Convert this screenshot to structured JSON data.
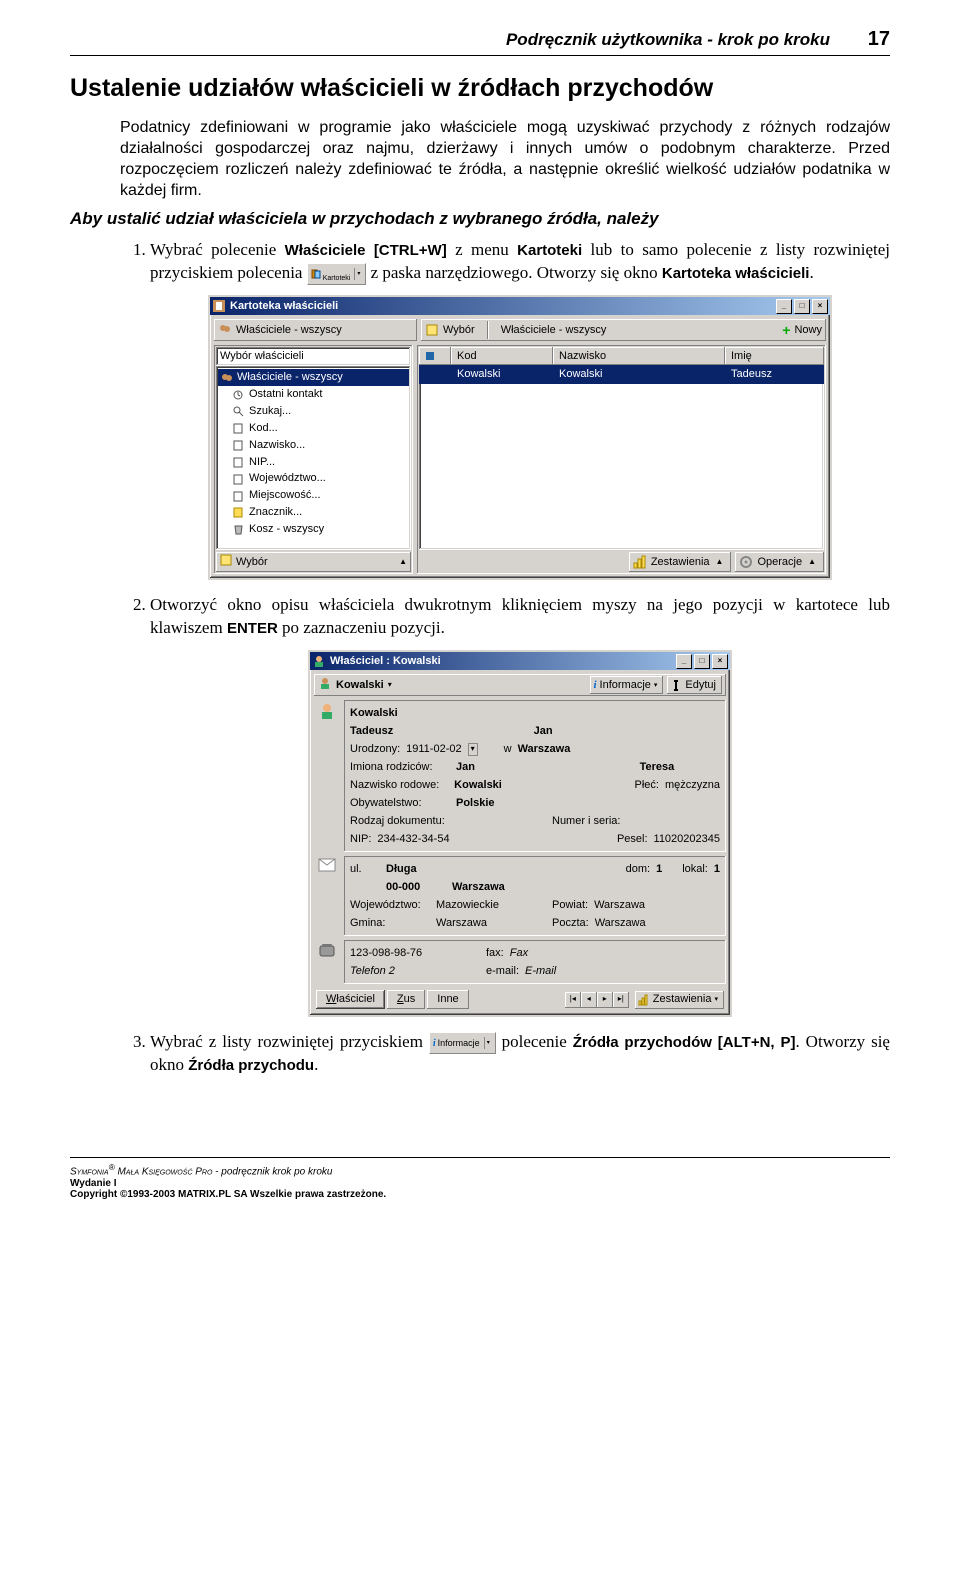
{
  "header": {
    "title": "Podręcznik użytkownika - krok po kroku",
    "page": "17"
  },
  "section_title": "Ustalenie udziałów właścicieli w źródłach przychodów",
  "intro_para": "Podatnicy zdefiniowani w programie jako właściciele mogą uzyskiwać przychody z różnych rodzajów działalności gospodarczej oraz najmu, dzierżawy i innych umów o podobnym charakterze. Przed rozpoczęciem rozliczeń należy zdefiniować te źródła, a następnie określić wielkość udziałów podatnika w każdej firm.",
  "lead_para": "Aby ustalić udział właściciela w przychodach z wybranego źródła, należy",
  "step1_a": "Wybrać polecenie ",
  "step1_b": "Właściciele",
  "step1_c": " [CTRL+W]",
  "step1_d": " z menu ",
  "step1_e": "Kartoteki",
  "step1_f": " lub to samo polecenie z listy rozwiniętej przyciskiem polecenia ",
  "step1_g": " z paska narzędziowego. Otworzy się okno ",
  "step1_h": "Kartoteka właścicieli",
  "kartoteki_btn": "Kartoteki",
  "step2_a": "Otworzyć okno opisu właściciela dwukrotnym kliknięciem myszy na jego pozycji w kartotece lub klawiszem ",
  "step2_b": "ENTER",
  "step2_c": " po zaznaczeniu pozycji.",
  "step3_a": "Wybrać z listy rozwiniętej przyciskiem ",
  "step3_b": " polecenie ",
  "step3_c": "Źródła przychodów",
  "step3_d": " [ALT+N, P]",
  "step3_e": ". Otworzy się okno ",
  "step3_f": "Źródła przychodu",
  "informacje_btn": "Informacje",
  "win1": {
    "title": "Kartoteka właścicieli",
    "toolbar_left": "Właściciele - wszyscy",
    "toolbar_wybor": "Wybór",
    "toolbar_desc": "Właściciele - wszyscy",
    "toolbar_nowy": "Nowy",
    "left_caption": "Wybór właścicieli",
    "tree": [
      "Właściciele - wszyscy",
      "Ostatni kontakt",
      "Szukaj...",
      "Kod...",
      "Nazwisko...",
      "NIP...",
      "Województwo...",
      "Miejscowość...",
      "Znacznik...",
      "Kosz - wszyscy"
    ],
    "left_tab": "Wybór",
    "grid_cols": {
      "c1": "Kod",
      "c2": "Nazwisko",
      "c3": "Imię"
    },
    "grid_row": {
      "c1": "Kowalski",
      "c2": "Kowalski",
      "c3": "Tadeusz"
    },
    "btn_zestawienia": "Zestawienia",
    "btn_operacje": "Operacje"
  },
  "win2": {
    "title": "Właściciel : Kowalski",
    "name_field": "Kowalski",
    "btn_info": "Informacje",
    "btn_edit": "Edytuj",
    "p1": {
      "nazwisko": "Kowalski",
      "imie": "Tadeusz",
      "imie2": "Jan",
      "urodzony_l": "Urodzony:",
      "urodzony_v": "1911-02-02",
      "w_l": "w",
      "w_v": "Warszawa",
      "rodzice_l": "Imiona rodziców:",
      "rodzice_v1": "Jan",
      "rodzice_v2": "Teresa",
      "rodowe_l": "Nazwisko rodowe:",
      "rodowe_v": "Kowalski",
      "plec_l": "Płeć:",
      "plec_v": "mężczyzna",
      "obyw_l": "Obywatelstwo:",
      "obyw_v": "Polskie",
      "dok_l": "Rodzaj dokumentu:",
      "numer_l": "Numer i seria:",
      "nip_l": "NIP:",
      "nip_v": "234-432-34-54",
      "pesel_l": "Pesel:",
      "pesel_v": "11020202345"
    },
    "p2": {
      "ul_l": "ul.",
      "ul_v": "Długa",
      "dom_l": "dom:",
      "dom_v": "1",
      "lokal_l": "lokal:",
      "lokal_v": "1",
      "kod_v": "00-000",
      "miasto_v": "Warszawa",
      "woj_l": "Województwo:",
      "woj_v": "Mazowieckie",
      "pow_l": "Powiat:",
      "pow_v": "Warszawa",
      "gmina_l": "Gmina:",
      "gmina_v": "Warszawa",
      "poczta_l": "Poczta:",
      "poczta_v": "Warszawa"
    },
    "p3": {
      "tel_v": "123-098-98-76",
      "fax_l": "fax:",
      "fax_v": "Fax",
      "tel2_v": "Telefon 2",
      "email_l": "e-mail:",
      "email_v": "E-mail"
    },
    "tabs": {
      "t1": "Właściciel",
      "t2": "Zus",
      "t3": "Inne",
      "t4": "Zestawienia"
    }
  },
  "footer": {
    "l1a": "Symfonia",
    "l1b": "®",
    "l1c": " Mała Księgowość Pro",
    "l1d": " - podręcznik krok po kroku",
    "l2": "Wydanie I",
    "l3": "Copyright ©1993-2003 MATRIX.PL SA Wszelkie prawa zastrzeżone."
  }
}
